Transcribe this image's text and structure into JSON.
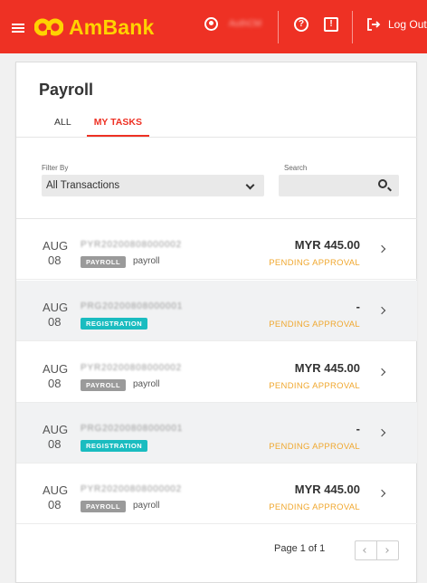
{
  "header": {
    "brand": "AmBank",
    "user_name": "AuthCM",
    "logout_label": "Log Out"
  },
  "page": {
    "title": "Payroll",
    "tabs": [
      {
        "label": "ALL"
      },
      {
        "label": "MY TASKS"
      }
    ],
    "active_tab": "MY TASKS"
  },
  "filter": {
    "label": "Filter By",
    "value": "All Transactions"
  },
  "search": {
    "label": "Search",
    "value": ""
  },
  "tasks": [
    {
      "month": "AUG",
      "day": "08",
      "ref": "PYR20200808000002",
      "badge": "PAYROLL",
      "badge_type": "payroll",
      "desc": "payroll",
      "amount": "MYR 445.00",
      "status": "PENDING APPROVAL"
    },
    {
      "month": "AUG",
      "day": "08",
      "ref": "PRG20200808000001",
      "badge": "REGISTRATION",
      "badge_type": "registration",
      "desc": "",
      "amount": "-",
      "status": "PENDING APPROVAL"
    },
    {
      "month": "AUG",
      "day": "08",
      "ref": "PYR20200808000002",
      "badge": "PAYROLL",
      "badge_type": "payroll",
      "desc": "payroll",
      "amount": "MYR 445.00",
      "status": "PENDING APPROVAL"
    },
    {
      "month": "AUG",
      "day": "08",
      "ref": "PRG20200808000001",
      "badge": "REGISTRATION",
      "badge_type": "registration",
      "desc": "",
      "amount": "-",
      "status": "PENDING APPROVAL"
    },
    {
      "month": "AUG",
      "day": "08",
      "ref": "PYR20200808000002",
      "badge": "PAYROLL",
      "badge_type": "payroll",
      "desc": "payroll",
      "amount": "MYR 445.00",
      "status": "PENDING APPROVAL"
    }
  ],
  "pagination": {
    "text": "Page 1 of 1"
  },
  "colors": {
    "brand_red": "#ee3124",
    "brand_yellow": "#ffd200",
    "pending": "#f0a830",
    "registration": "#1abcc0",
    "payroll": "#9a9a9a"
  },
  "icons": [
    "menu-icon",
    "user-icon",
    "help-icon",
    "alert-icon",
    "logout-icon",
    "chevron-down-icon",
    "search-icon",
    "chevron-right-icon"
  ]
}
